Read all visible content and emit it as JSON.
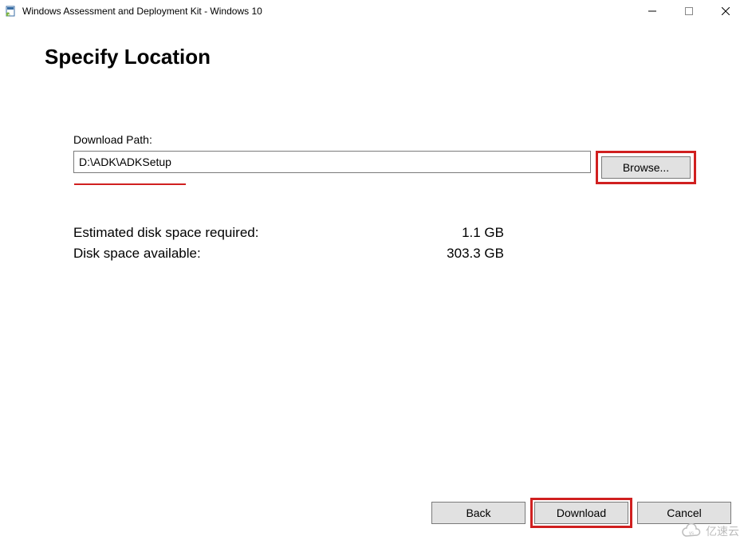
{
  "titlebar": {
    "title": "Windows Assessment and Deployment Kit - Windows 10"
  },
  "page": {
    "heading": "Specify Location"
  },
  "form": {
    "download_path_label": "Download Path:",
    "download_path_value": "D:\\ADK\\ADKSetup",
    "browse_label": "Browse..."
  },
  "info": {
    "estimated_label": "Estimated disk space required:",
    "estimated_value": "1.1 GB",
    "available_label": "Disk space available:",
    "available_value": "303.3 GB"
  },
  "footer": {
    "back_label": "Back",
    "download_label": "Download",
    "cancel_label": "Cancel"
  },
  "watermark": {
    "text": "亿速云"
  }
}
